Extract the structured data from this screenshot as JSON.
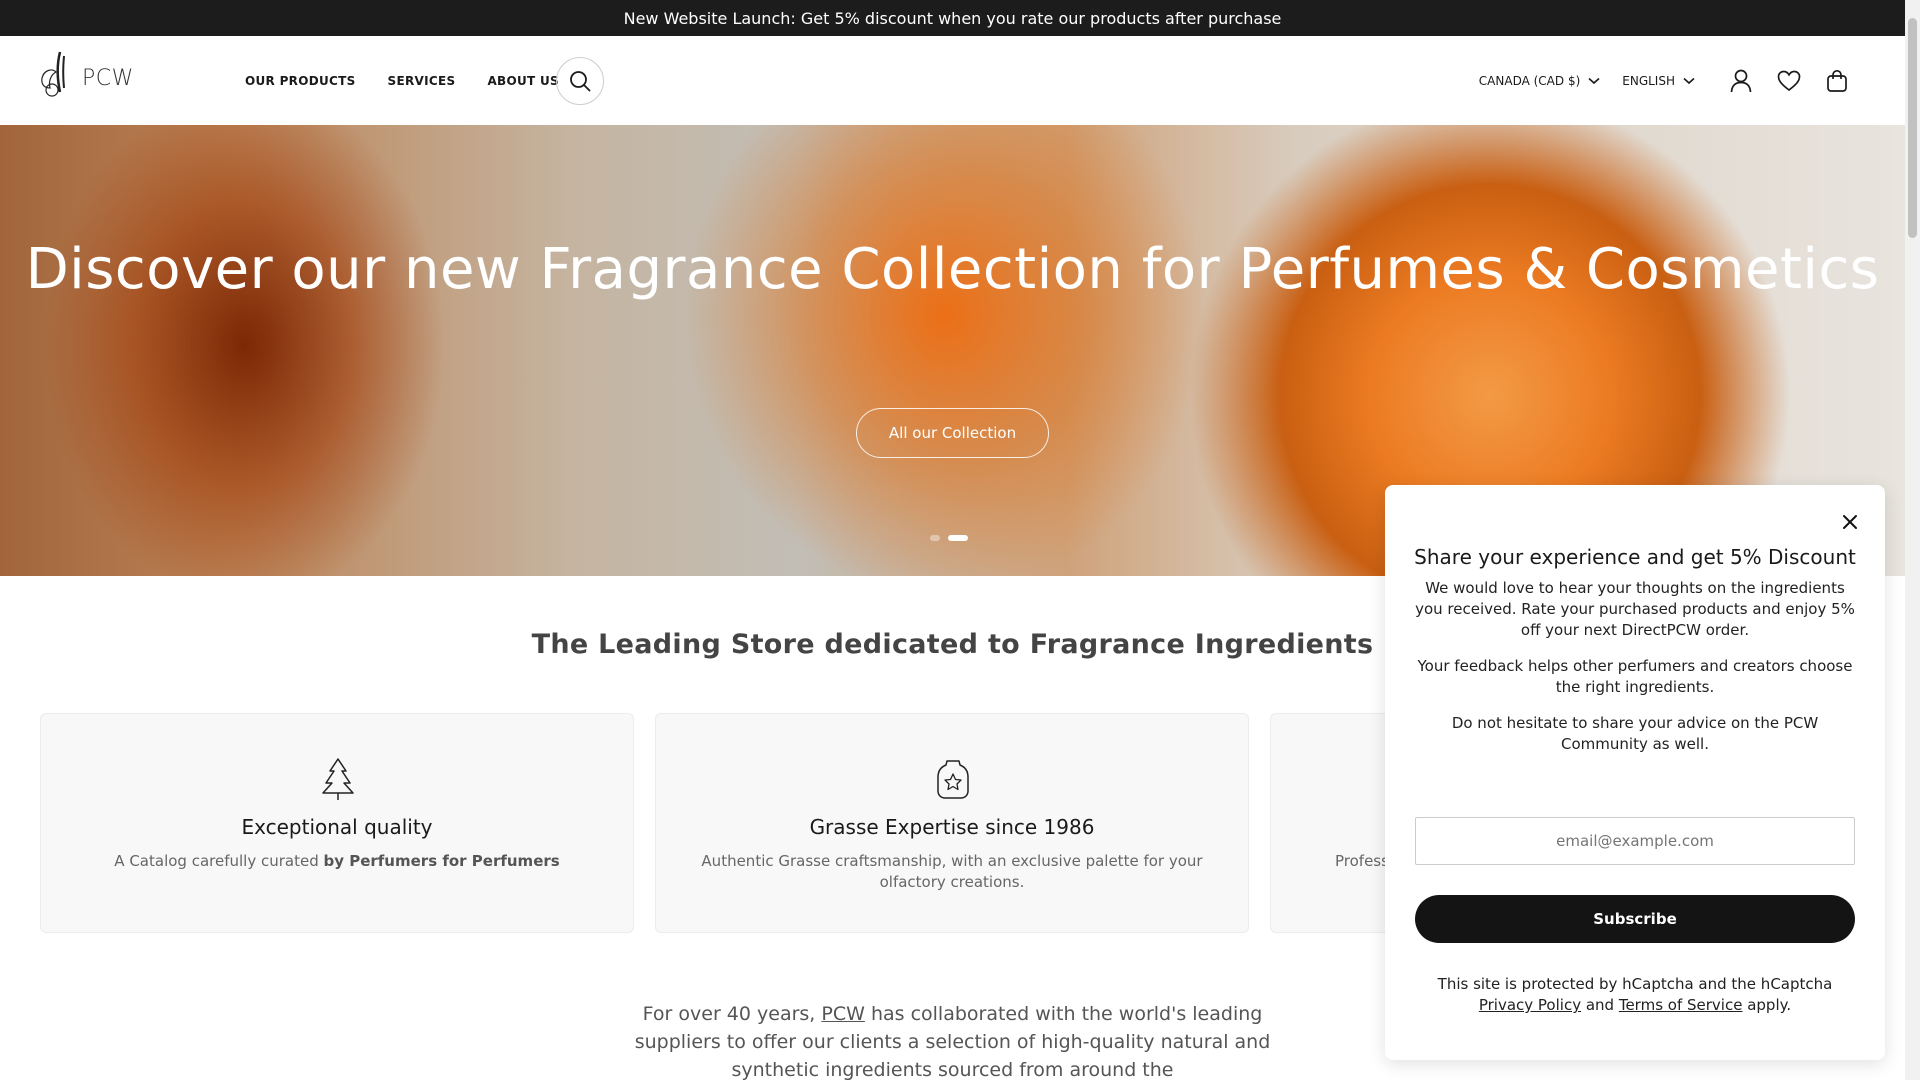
{
  "announcement": "New Website Launch: Get 5% discount when you rate our products after purchase",
  "header": {
    "logo_text": "PCW",
    "nav": [
      "OUR PRODUCTS",
      "SERVICES",
      "ABOUT US"
    ],
    "currency": "CANADA (CAD $)",
    "language": "ENGLISH",
    "icons": [
      "search-icon",
      "account-icon",
      "wishlist-icon",
      "cart-icon"
    ]
  },
  "hero": {
    "title": "Discover our new Fragrance Collection for Perfumes & Cosmetics",
    "button": "All our Collection",
    "slides": 2,
    "active_slide": 2
  },
  "section": {
    "title": "The Leading Store dedicated to Fragrance Ingredients"
  },
  "cards": [
    {
      "icon": "tree-icon",
      "title": "Exceptional quality",
      "text_before": "A Catalog carefully curated ",
      "text_bold": "by Perfumers for Perfumers"
    },
    {
      "icon": "badge-star-icon",
      "title": "Grasse Expertise since 1986",
      "text": "Authentic Grasse craftsmanship, with an exclusive palette for your olfactory creations."
    },
    {
      "icon": "hidden-icon",
      "title": "",
      "text": "Profess"
    }
  ],
  "about": {
    "before": "For over 40 years, ",
    "link": "PCW",
    "after": " has collaborated with the world's leading suppliers to offer our clients a selection of high-quality natural and synthetic ingredients sourced from around the"
  },
  "popup": {
    "title": "Share your experience and get 5% Discount",
    "p1": "We would love to hear your thoughts on the ingredients you received. Rate your purchased products and enjoy 5% off your next DirectPCW order.",
    "p2": "Your feedback helps other perfumers and creators choose the right ingredients.",
    "p3": "Do not hesitate to share your advice on the PCW Community as well.",
    "email_placeholder": "email@example.com",
    "subscribe": "Subscribe",
    "legal_before": "This site is protected by hCaptcha and the hCaptcha ",
    "privacy": "Privacy Policy",
    "and": " and ",
    "terms": "Terms of Service",
    "legal_after": " apply."
  },
  "colors": {
    "accent": "#141414",
    "announcement_bg": "#1c1c1c"
  }
}
